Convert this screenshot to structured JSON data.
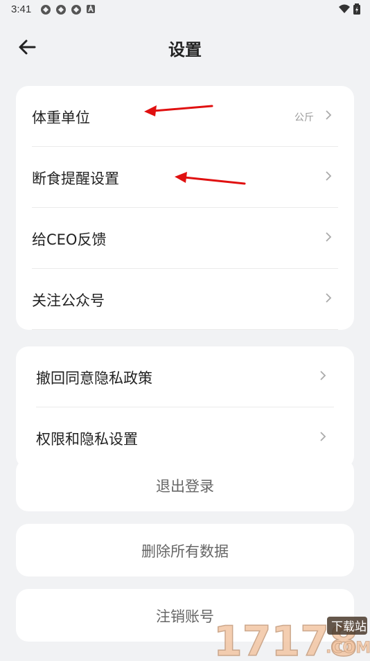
{
  "status_bar": {
    "time": "3:41"
  },
  "header": {
    "title": "设置"
  },
  "group1": {
    "items": [
      {
        "label": "体重单位",
        "value": "公斤"
      },
      {
        "label": "断食提醒设置"
      },
      {
        "label": "给CEO反馈"
      },
      {
        "label": "关注公众号"
      }
    ]
  },
  "group2": {
    "items": [
      {
        "label": "撤回同意隐私政策"
      },
      {
        "label": "权限和隐私设置"
      }
    ]
  },
  "actions": {
    "logout": "退出登录",
    "delete_all": "删除所有数据",
    "cancel_account": "注销账号"
  },
  "watermark": {
    "number": "17178",
    "tag": "下载站",
    "domain": ".COM"
  },
  "colors": {
    "background": "#f1f2f4",
    "card": "#ffffff",
    "annotation_arrow": "#e01010"
  }
}
